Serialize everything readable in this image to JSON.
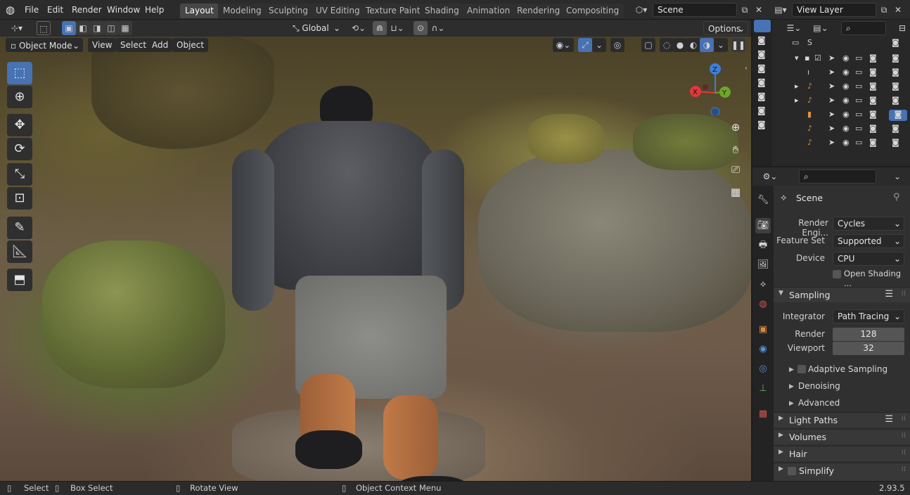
{
  "menu": {
    "blender_icon": "blender-logo",
    "file": "File",
    "edit": "Edit",
    "render": "Render",
    "window": "Window",
    "help": "Help"
  },
  "workspaces": [
    "Layout",
    "Modeling",
    "Sculpting",
    "UV Editing",
    "Texture Paint",
    "Shading",
    "Animation",
    "Rendering",
    "Compositing"
  ],
  "active_workspace": "Layout",
  "scene_field": "Scene",
  "view_layer_field": "View Layer",
  "toolbar": {
    "transform_orientation": "Global",
    "options": "Options"
  },
  "viewport_header": {
    "mode": "Object Mode",
    "view": "View",
    "select": "Select",
    "add": "Add",
    "object": "Object"
  },
  "gizmo": {
    "z": "Z",
    "y": "Y",
    "x": "X"
  },
  "outliner": {
    "scene_row": "S"
  },
  "properties": {
    "context": "Scene",
    "render_engine_label": "Render Engi...",
    "render_engine": "Cycles",
    "feature_set_label": "Feature Set",
    "feature_set": "Supported",
    "device_label": "Device",
    "device": "CPU",
    "open_shading": "Open Shading ...",
    "sampling": "Sampling",
    "integrator_label": "Integrator",
    "integrator": "Path Tracing",
    "render_label": "Render",
    "render_value": "128",
    "viewport_label": "Viewport",
    "viewport_value": "32",
    "adaptive_sampling": "Adaptive Sampling",
    "denoising": "Denoising",
    "advanced": "Advanced",
    "light_paths": "Light Paths",
    "volumes": "Volumes",
    "hair": "Hair",
    "simplify": "Simplify"
  },
  "status": {
    "select": "Select",
    "box_select": "Box Select",
    "rotate_view": "Rotate View",
    "context_menu": "Object Context Menu",
    "version": "2.93.5"
  },
  "colors": {
    "accent": "#4772b3",
    "x_axis": "#e0383c",
    "y_axis": "#6ea628",
    "z_axis": "#3e7ed8"
  }
}
